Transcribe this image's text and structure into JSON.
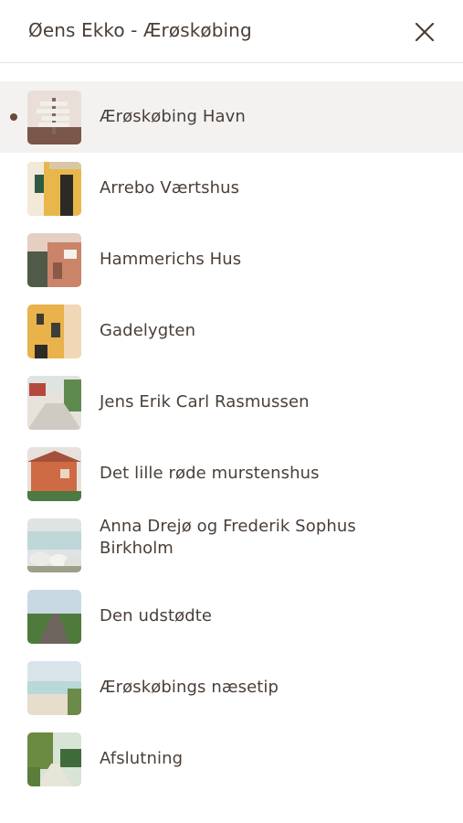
{
  "header": {
    "title": "Øens Ekko - Ærøskøbing",
    "close_icon": "close-icon"
  },
  "playlist": {
    "active_index": 0,
    "active_color": "#6b4a37",
    "items": [
      {
        "label": "Ærøskøbing Havn",
        "icon": "signpost-thumbnail"
      },
      {
        "label": "Arrebo Værtshus",
        "icon": "yellow-house-thumbnail"
      },
      {
        "label": "Hammerichs Hus",
        "icon": "house-sign-thumbnail"
      },
      {
        "label": "Gadelygten",
        "icon": "street-lamp-thumbnail"
      },
      {
        "label": "Jens Erik Carl Rasmussen",
        "icon": "street-thumbnail"
      },
      {
        "label": "Det lille røde murstenshus",
        "icon": "red-brick-house-thumbnail"
      },
      {
        "label": "Anna Drejø og Frederik Sophus Birkholm",
        "icon": "stones-sea-thumbnail"
      },
      {
        "label": "Den udstødte",
        "icon": "road-thumbnail"
      },
      {
        "label": "Ærøskøbings næsetip",
        "icon": "beach-thumbnail"
      },
      {
        "label": "Afslutning",
        "icon": "path-trees-thumbnail"
      }
    ]
  }
}
